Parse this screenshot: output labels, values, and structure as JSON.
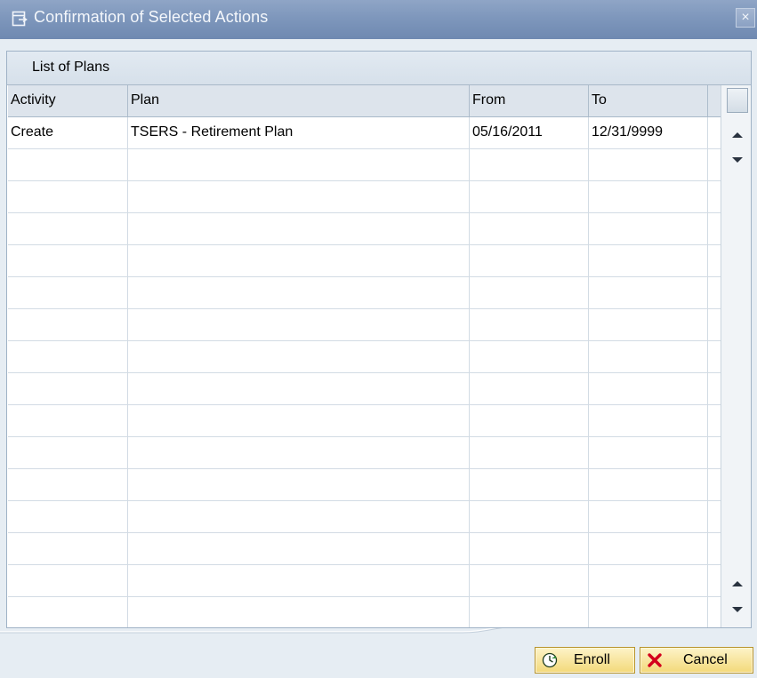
{
  "window": {
    "title": "Confirmation of Selected Actions",
    "close_label": "×"
  },
  "panel": {
    "title": "List of Plans"
  },
  "table": {
    "columns": [
      "Activity",
      "Plan",
      "From",
      "To"
    ],
    "rows": [
      [
        "Create",
        "TSERS - Retirement Plan",
        "05/16/2011",
        "12/31/9999"
      ],
      [
        "",
        "",
        "",
        ""
      ],
      [
        "",
        "",
        "",
        ""
      ],
      [
        "",
        "",
        "",
        ""
      ],
      [
        "",
        "",
        "",
        ""
      ],
      [
        "",
        "",
        "",
        ""
      ],
      [
        "",
        "",
        "",
        ""
      ],
      [
        "",
        "",
        "",
        ""
      ],
      [
        "",
        "",
        "",
        ""
      ],
      [
        "",
        "",
        "",
        ""
      ],
      [
        "",
        "",
        "",
        ""
      ],
      [
        "",
        "",
        "",
        ""
      ],
      [
        "",
        "",
        "",
        ""
      ],
      [
        "",
        "",
        "",
        ""
      ],
      [
        "",
        "",
        "",
        ""
      ],
      [
        "",
        "",
        "",
        ""
      ]
    ]
  },
  "scrollbar": {
    "icons": [
      "column-settings-icon",
      "scroll-up-icon",
      "scroll-down-icon"
    ]
  },
  "buttons": {
    "enroll_label": "Enroll",
    "cancel_label": "Cancel"
  },
  "colors": {
    "titlebar": "#7e97bc",
    "button_bg": "#f3d979",
    "cancel_x": "#d3001c",
    "enroll_icon": "#2f8a36"
  }
}
